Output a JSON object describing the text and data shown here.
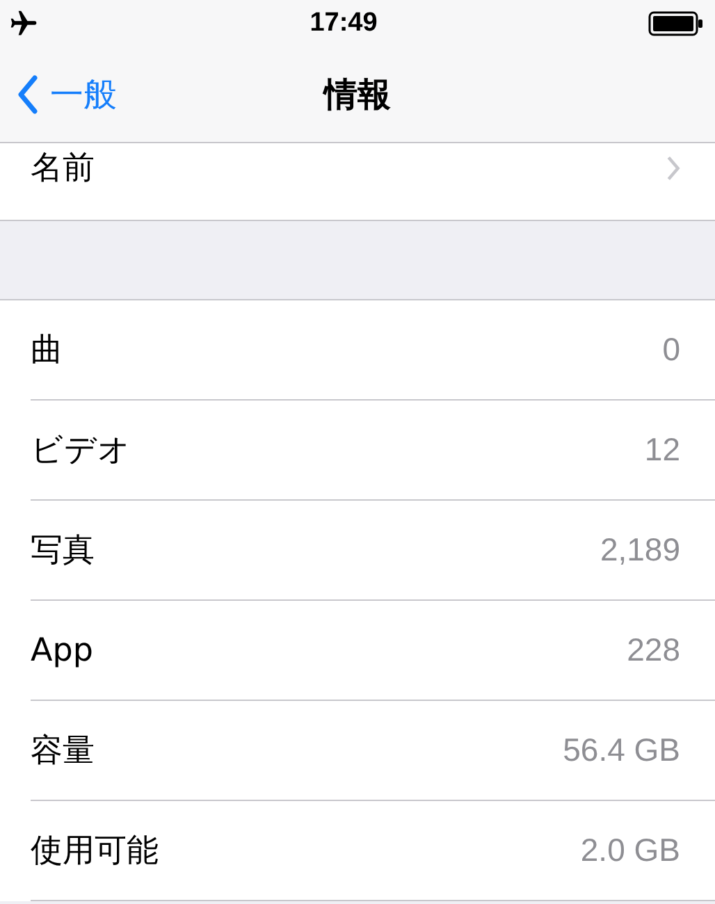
{
  "status_bar": {
    "time": "17:49"
  },
  "nav_bar": {
    "back": "一般",
    "title": "情報"
  },
  "name_row": {
    "label": "名前"
  },
  "rows": [
    {
      "label": "曲",
      "value": "0"
    },
    {
      "label": "ビデオ",
      "value": "12"
    },
    {
      "label": "写真",
      "value": "2,189"
    },
    {
      "label": "App",
      "value": "228"
    },
    {
      "label": "容量",
      "value": "56.4 GB"
    },
    {
      "label": "使用可能",
      "value": "2.0 GB"
    }
  ]
}
